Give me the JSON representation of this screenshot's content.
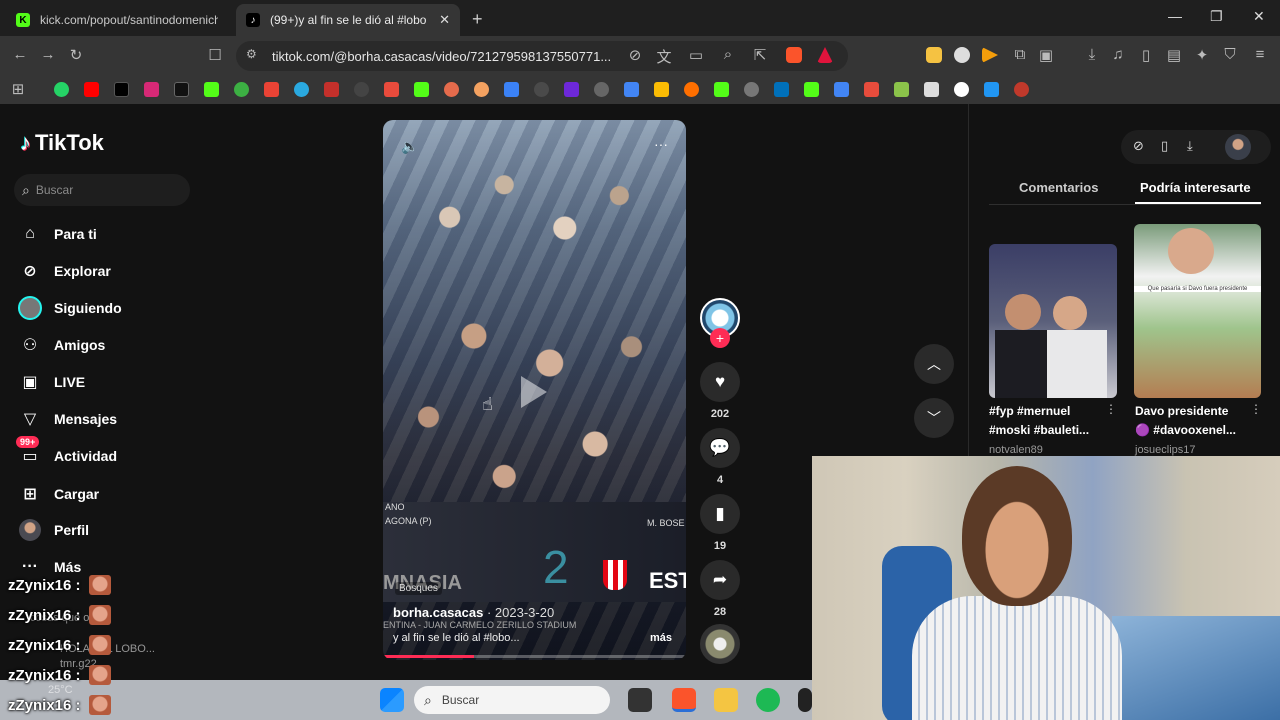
{
  "browser": {
    "tabs": [
      {
        "title": "kick.com/popout/santinodomenichin",
        "favicon": "K",
        "color": "#53fc18"
      },
      {
        "title": "(99+)y al fin se le dió al #lobo",
        "favicon": "♪",
        "color": "#000000"
      }
    ],
    "url": "tiktok.com/@borha.casacas/video/721279598137550771..."
  },
  "sidebar": {
    "brand": "TikTok",
    "search_placeholder": "Buscar",
    "items": [
      {
        "label": "Para ti",
        "icon": "home-icon"
      },
      {
        "label": "Explorar",
        "icon": "compass-icon"
      },
      {
        "label": "Siguiendo",
        "icon": "following-avatar-icon"
      },
      {
        "label": "Amigos",
        "icon": "friends-icon"
      },
      {
        "label": "LIVE",
        "icon": "live-icon"
      },
      {
        "label": "Mensajes",
        "icon": "messages-icon"
      },
      {
        "label": "Actividad",
        "icon": "activity-icon",
        "badge": "99+"
      },
      {
        "label": "Cargar",
        "icon": "upload-icon"
      },
      {
        "label": "Perfil",
        "icon": "profile-icon"
      },
      {
        "label": "Más",
        "icon": "more-icon"
      }
    ]
  },
  "video": {
    "author": "borha.casacas",
    "date": "2023-3-20",
    "caption": "y al fin se le dió al #lobo...",
    "more": "más",
    "tag": "Bosques",
    "score": "2",
    "team_right": "EST",
    "team_left": "MNASIA",
    "overlay_line1": "ANO",
    "overlay_line2": "AGONA (P)",
    "overlay_right": "M. BOSE",
    "stadium": "ENTINA - JUAN CARMELO ZERILLO STADIUM",
    "progress": 0.3
  },
  "actions": {
    "likes": "202",
    "comments": "4",
    "saves": "19",
    "shares": "28"
  },
  "right_panel": {
    "tabs": [
      "Comentarios",
      "Podría interesarte"
    ],
    "active_tab": "Podría interesarte",
    "cards": [
      {
        "title_line1": "#fyp #mernuel",
        "title_line2": "#moski #bauleti...",
        "user": "notvalen89"
      },
      {
        "title_line1": "Davo presidente",
        "title_line2": "🟣 #davooxenel...",
        "user": "josueclips17",
        "thumb_caption": "Que pasaría si Davo fuera presidente"
      }
    ]
  },
  "chat": {
    "user": "zZynix16 :",
    "rows": 5,
    "ghost_text": [
      "cosas que os",
      "HOLA · EL LOBO...",
      "tmr.g22",
      "25°C"
    ]
  },
  "taskbar": {
    "search_placeholder": "Buscar"
  }
}
